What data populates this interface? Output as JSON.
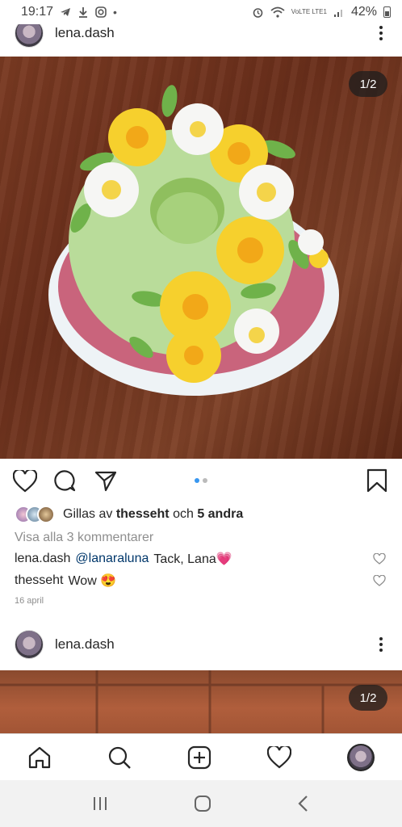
{
  "status_bar": {
    "time": "19:17",
    "battery": "42%",
    "network": "VoLTE LTE1",
    "icons": [
      "telegram-icon",
      "download-icon",
      "instagram-icon",
      "alarm-icon",
      "wifi-icon",
      "signal-icon",
      "battery-icon"
    ]
  },
  "post1": {
    "username": "lena.dash",
    "image_counter": "1/2",
    "liked_by_prefix": "Gillas av",
    "liked_by_user": "thesseht",
    "liked_by_joiner": "och",
    "liked_by_others": "5 andra",
    "view_all_comments": "Visa alla 3 kommentarer",
    "comments": [
      {
        "user": "lena.dash",
        "mention": "@lanaraluna",
        "text": "Tack, Lana💗"
      },
      {
        "user": "thesseht",
        "mention": "",
        "text": "Wow 😍"
      }
    ],
    "date": "16 april"
  },
  "post2": {
    "username": "lena.dash",
    "image_counter": "1/2"
  },
  "bottom_nav": [
    "home-icon",
    "search-icon",
    "new-post-icon",
    "activity-icon",
    "profile-avatar"
  ],
  "system_nav": [
    "recents-icon",
    "home-circle-icon",
    "back-icon"
  ],
  "colors": {
    "accent": "#3897f0",
    "text": "#262626",
    "muted": "#8e8e8e"
  }
}
